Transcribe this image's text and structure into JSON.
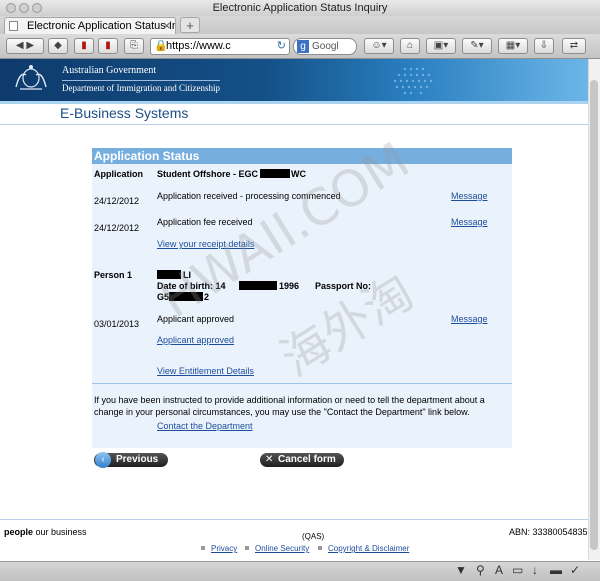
{
  "window": {
    "title": "Electronic Application Status Inquiry"
  },
  "tab": {
    "title": "Electronic Application Status In...",
    "close": "×",
    "new_tab": "+"
  },
  "toolbar": {
    "url": "https://www.c",
    "search_placeholder": "Googl"
  },
  "banner": {
    "gov": "Australian Government",
    "dept": "Department of Immigration and Citizenship"
  },
  "site": {
    "section_title": "E-Business Systems"
  },
  "status": {
    "header": "Application Status",
    "application_label": "Application",
    "application_value_prefix": "Student Offshore - EGC",
    "application_value_suffix": "WC",
    "events": [
      {
        "date": "24/12/2012",
        "text": "Application received - processing commenced",
        "message": "Message"
      },
      {
        "date": "24/12/2012",
        "text": "Application fee received",
        "message": "Message"
      }
    ],
    "receipt_link": "View your receipt details",
    "person_label": "Person 1",
    "person_name_suffix": "LI",
    "dob_label": "Date of birth: 14",
    "dob_year": "1996",
    "passport_label": "Passport No:",
    "passport_prefix": "G5",
    "passport_suffix": "2",
    "person_event": {
      "date": "03/01/2013",
      "text": "Applicant approved",
      "message": "Message"
    },
    "approved_link": "Applicant approved",
    "entitlement_link": "View Entitlement Details",
    "notice": "If you have been instructed to provide additional information or need to tell the department about a change in your personal circumstances, you may use the \"Contact the Department\" link below.",
    "contact_link": "Contact the Department"
  },
  "buttons": {
    "previous": "Previous",
    "cancel": "Cancel form"
  },
  "footer": {
    "people_bold": "people",
    "people_rest": " our business",
    "abn": "ABN: 33380054835",
    "qas": "(QAS)",
    "links": [
      "Privacy",
      "Online Security",
      "Copyright & Disclaimer"
    ]
  },
  "watermark": {
    "line1": "HWAII.COM",
    "line2": "海外淘"
  }
}
